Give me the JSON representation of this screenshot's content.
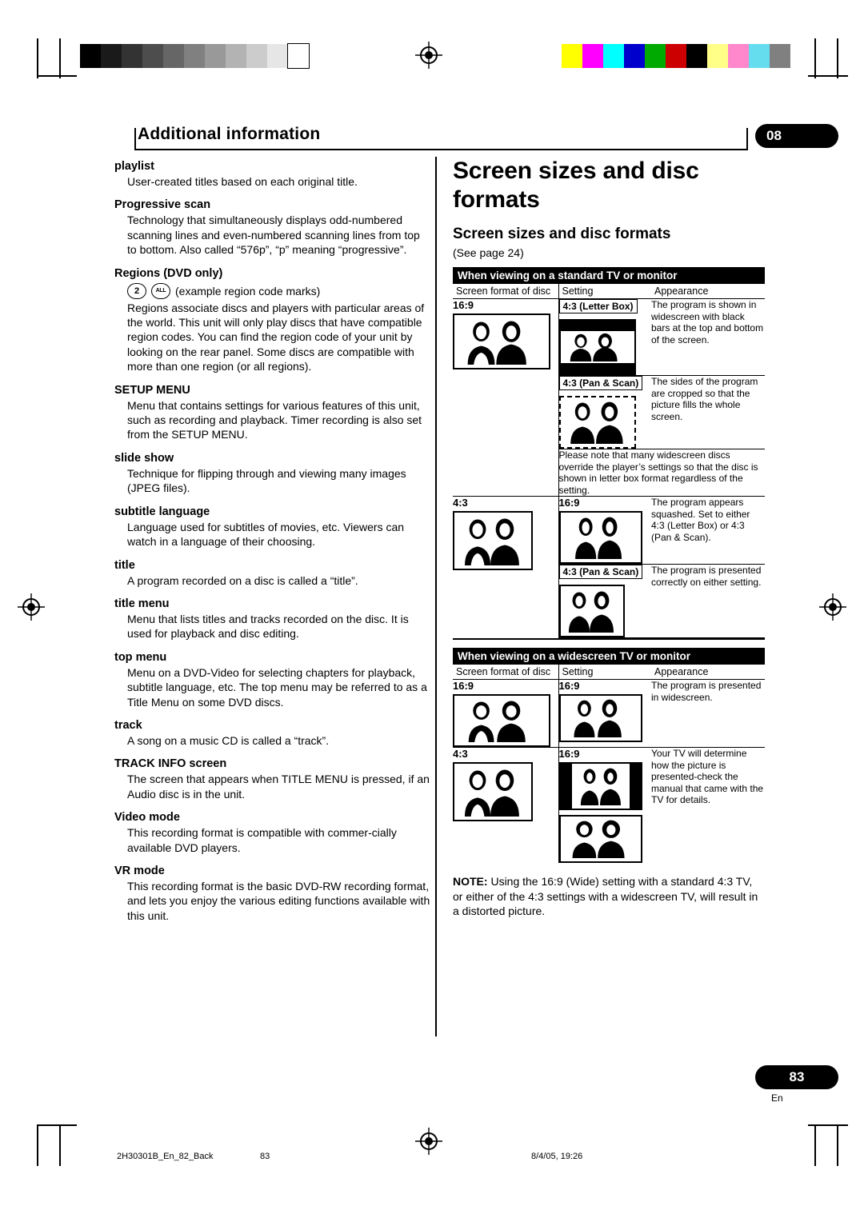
{
  "header": {
    "title": "Additional information",
    "chapter": "08",
    "page_number": "83",
    "lang": "En"
  },
  "left_column": {
    "entries": [
      {
        "term": "playlist",
        "text": "User-created titles based on each original title."
      },
      {
        "term": "Progressive scan",
        "text": "Technology that simultaneously displays odd-numbered scanning lines and even-numbered scanning lines from top to bottom. Also called “576p”, “p” meaning “progressive”."
      },
      {
        "term": "Regions (DVD only)",
        "text": "Regions associate discs and players with particular areas of the world. This unit will only play discs that have compatible region codes. You can find the region code of your unit by looking on the rear panel. Some discs are compatible with more than one region (or all regions)."
      },
      {
        "term": "SETUP MENU",
        "text": "Menu that contains settings for various features of this unit, such as recording and playback. Timer recording is also set from the SETUP MENU."
      },
      {
        "term": "slide show",
        "text": "Technique for flipping through and viewing many images (JPEG files)."
      },
      {
        "term": "subtitle language",
        "text": "Language used for subtitles of movies, etc. Viewers can watch in a language of their choosing."
      },
      {
        "term": "title",
        "text": "A program recorded on a disc is called a “title”."
      },
      {
        "term": "title menu",
        "text": "Menu that lists titles and tracks recorded on the disc. It is used for playback and disc editing."
      },
      {
        "term": "top menu",
        "text": "Menu on a DVD-Video for selecting chapters for playback, subtitle language, etc. The top menu may be referred to as a Title Menu on some DVD discs."
      },
      {
        "term": "track",
        "text": "A song on a music CD is called a “track”."
      },
      {
        "term": "TRACK INFO screen",
        "text": "The screen that appears when TITLE MENU is pressed, if an Audio disc is in the unit."
      },
      {
        "term": "Video mode",
        "text": "This recording format is compatible with commer-cially available DVD players."
      },
      {
        "term": "VR mode",
        "text": "This recording format is the basic DVD-RW recording format, and lets you enjoy the various editing functions available with this unit."
      }
    ],
    "region_marks": {
      "mark1": "2",
      "mark2": "ALL",
      "caption": "(example region code marks)"
    }
  },
  "right_column": {
    "big_title": "Screen sizes and disc formats",
    "sub_title": "Screen sizes and disc formats",
    "see_page": "(See page 24)",
    "table1": {
      "banner": "When viewing on a standard TV or monitor",
      "head_disc": "Screen format of disc",
      "head_setting": "Setting",
      "head_appearance": "Appearance",
      "rows": [
        {
          "disc": "16:9",
          "settings": [
            {
              "setting": "4:3 (Letter Box)",
              "appearance": "The program is shown in widescreen with black bars at the top and bottom of the screen."
            },
            {
              "setting": "4:3 (Pan & Scan)",
              "appearance": "The sides of the program are cropped so that the picture fills the whole screen."
            }
          ],
          "note": "Please note that many widescreen discs override the player’s settings so that the disc is shown in letter box format regardless of the setting."
        },
        {
          "disc": "4:3",
          "settings": [
            {
              "setting": "16:9",
              "appearance": "The program appears squashed. Set to either 4:3 (Letter Box) or 4:3 (Pan & Scan)."
            },
            {
              "setting": "4:3 (Pan & Scan)",
              "appearance": "The program is presented correctly on either setting."
            }
          ],
          "note": ""
        }
      ]
    },
    "table2": {
      "banner": "When viewing on a widescreen TV or monitor",
      "head_disc": "Screen format of disc",
      "head_setting": "Setting",
      "head_appearance": "Appearance",
      "rows": [
        {
          "disc": "16:9",
          "settings": [
            {
              "setting": "16:9",
              "appearance": "The program is presented in widescreen."
            }
          ]
        },
        {
          "disc": "4:3",
          "settings": [
            {
              "setting": "16:9",
              "appearance": "Your TV will determine how the picture is presented-check the manual that came with the TV for details."
            }
          ]
        }
      ]
    },
    "note": {
      "label": "NOTE:",
      "text": "Using the 16:9 (Wide) setting with a standard 4:3 TV, or either of the 4:3 settings with a widescreen TV, will result in a distorted picture."
    }
  },
  "footer": {
    "file": "2H30301B_En_82_Back",
    "page": "83",
    "date": "8/4/05, 19:26"
  },
  "colors": {
    "bar_colors": [
      "#ffff00",
      "#ff00ff",
      "#00ffff",
      "#0000cc",
      "#00aa00",
      "#cc0000",
      "#000000",
      "#ffff88",
      "#ff88cc",
      "#66ddee",
      "#808080"
    ],
    "grey_steps": [
      "#000000",
      "#1a1a1a",
      "#333333",
      "#4d4d4d",
      "#666666",
      "#808080",
      "#999999",
      "#b3b3b3",
      "#cccccc",
      "#e6e6e6",
      "#ffffff"
    ]
  }
}
